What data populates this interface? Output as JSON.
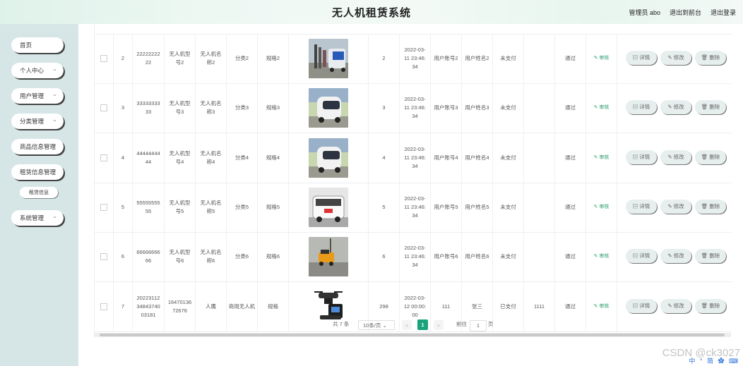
{
  "header": {
    "title": "无人机租赁系统",
    "admin": "管理员 abo",
    "to_front": "退出到前台",
    "logout": "退出登录"
  },
  "sidebar": {
    "items": [
      {
        "label": "首页"
      },
      {
        "label": "个人中心"
      },
      {
        "label": "用户管理"
      },
      {
        "label": "分类管理"
      },
      {
        "label": "商品信息管理"
      },
      {
        "label": "租赁信息管理"
      },
      {
        "label": "租赁信息"
      },
      {
        "label": "系统管理"
      }
    ]
  },
  "table": {
    "rows": [
      {
        "idx": "2",
        "no": "2222222222",
        "model": "无人机型号2",
        "name": "无人机名称2",
        "cat": "分类2",
        "spec": "规格2",
        "img": "van",
        "qty": "2",
        "time": "2022-03-11 23:46:34",
        "acct": "用户账号2",
        "uname": "用户姓名2",
        "pay": "未支付",
        "amt": "",
        "status": "通过",
        "audit": "审核"
      },
      {
        "idx": "3",
        "no": "3333333333",
        "model": "无人机型号3",
        "name": "无人机名称3",
        "cat": "分类3",
        "spec": "规格3",
        "img": "pod",
        "qty": "3",
        "time": "2022-03-11 23:46:34",
        "acct": "用户账号3",
        "uname": "用户姓名3",
        "pay": "未支付",
        "amt": "",
        "status": "通过",
        "audit": "审核"
      },
      {
        "idx": "4",
        "no": "4444444444",
        "model": "无人机型号4",
        "name": "无人机名称4",
        "cat": "分类4",
        "spec": "规格4",
        "img": "pod",
        "qty": "4",
        "time": "2022-03-11 23:46:34",
        "acct": "用户账号4",
        "uname": "用户姓名4",
        "pay": "未支付",
        "amt": "",
        "status": "通过",
        "audit": "审核"
      },
      {
        "idx": "5",
        "no": "5555555555",
        "model": "无人机型号5",
        "name": "无人机名称5",
        "cat": "分类5",
        "spec": "规格5",
        "img": "bus",
        "qty": "5",
        "time": "2022-03-11 23:46:34",
        "acct": "用户账号5",
        "uname": "用户姓名5",
        "pay": "未支付",
        "amt": "",
        "status": "通过",
        "audit": "审核"
      },
      {
        "idx": "6",
        "no": "6666666666",
        "model": "无人机型号6",
        "name": "无人机名称6",
        "cat": "分类6",
        "spec": "规格6",
        "img": "cart",
        "qty": "6",
        "time": "2022-03-11 23:46:34",
        "acct": "用户账号6",
        "uname": "用户姓名6",
        "pay": "未支付",
        "amt": "",
        "status": "通过",
        "audit": "审核"
      },
      {
        "idx": "7",
        "no": "202231123484374003181",
        "model": "1647013672676",
        "name": "人鹰",
        "cat": "商用无人机",
        "spec": "规格",
        "img": "drone",
        "qty": "298",
        "time": "2022-03-12 00:00:00",
        "acct": "111",
        "uname": "张三",
        "pay": "已支付",
        "amt": "1111",
        "status": "通过",
        "audit": "审核"
      }
    ],
    "actions": {
      "detail": "详情",
      "edit": "修改",
      "delete": "删除"
    }
  },
  "pager": {
    "total": "共 7 条",
    "size": "10条/页",
    "prev": "<",
    "current": "1",
    "next": ">",
    "goto": "前往",
    "goto_value": "1",
    "page_unit": "页"
  },
  "watermark": "CSDN @ck3027",
  "ime": "中 ° 简 ✿ ⌨"
}
